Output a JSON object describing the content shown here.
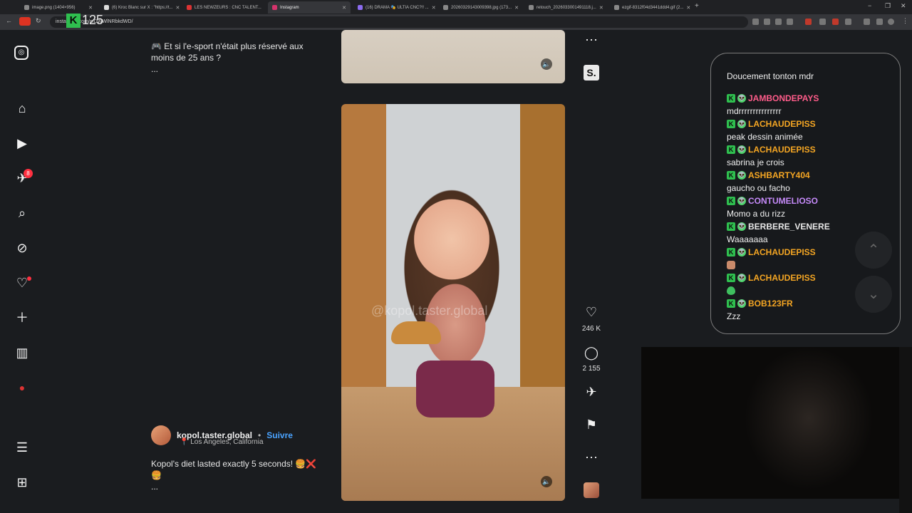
{
  "browser": {
    "tabs": [
      {
        "title": "image.png (1404×956)",
        "active": false
      },
      {
        "title": "(6) Kroc Blanc sur X : \"https://t...",
        "active": false
      },
      {
        "title": "LES NEWZEURS : CNC TALENT...",
        "active": false
      },
      {
        "title": "Instagram",
        "active": true
      },
      {
        "title": "(16) DRAMA 🎭 ULTIA CNC?!! ...",
        "active": false
      },
      {
        "title": "20260329143009398.jpg (173...",
        "active": false
      },
      {
        "title": "retouch_2026033001491118.j...",
        "active": false
      },
      {
        "title": "ezgif-8312f04d3441ddd4.gif (2...",
        "active": false
      }
    ],
    "url": "instagram.com/p/DWWlNRbkdWD/",
    "overlay_logo": {
      "letter": "K",
      "number": "125"
    }
  },
  "sidebar": {
    "notification_count": "8"
  },
  "posts": {
    "top_caption_line1": "🎮 Et si l'e-sport n'était plus réservé aux",
    "top_caption_line2": "moins de 25 ans ?",
    "top_more": "...",
    "author": "kopol.taster.global",
    "separator": "•",
    "follow": "Suivre",
    "location": "📍 Los Angeles, California",
    "caption_line1": "Kopol's diet lasted exactly 5 seconds! 🍔❌",
    "caption_line2": "🍔",
    "more": "...",
    "watermark": "@kopol.taster.global"
  },
  "actions": {
    "likes": "246 K",
    "comments": "2 155"
  },
  "chat": {
    "messages": [
      {
        "user": "",
        "text": "Doucement tonton mdr",
        "color": "#9a9a9a"
      },
      {
        "user": "JAMBONDEPAYS",
        "text": "mdrrrrrrrrrrrrrrr",
        "color": "#ff5c8a"
      },
      {
        "user": "LACHAUDEPISS",
        "text": "peak dessin animée",
        "color": "#f5a623"
      },
      {
        "user": "LACHAUDEPISS",
        "text": "sabrina je crois",
        "color": "#f5a623"
      },
      {
        "user": "ASHBARTY404",
        "text": "gaucho ou facho",
        "color": "#f5a623"
      },
      {
        "user": "CONTUMELIOSO",
        "text": "Momo a du rizz",
        "color": "#c58af9"
      },
      {
        "user": "BERBERE_VENERE",
        "text": "Waaaaaaa",
        "color": "#e8e8e8"
      },
      {
        "user": "LACHAUDEPISS",
        "text": "",
        "color": "#f5a623"
      },
      {
        "user": "LACHAUDEPISS",
        "text": "",
        "color": "#f5a623"
      },
      {
        "user": "BOB123FR",
        "text": "Zzz",
        "color": "#f5a623"
      }
    ]
  }
}
